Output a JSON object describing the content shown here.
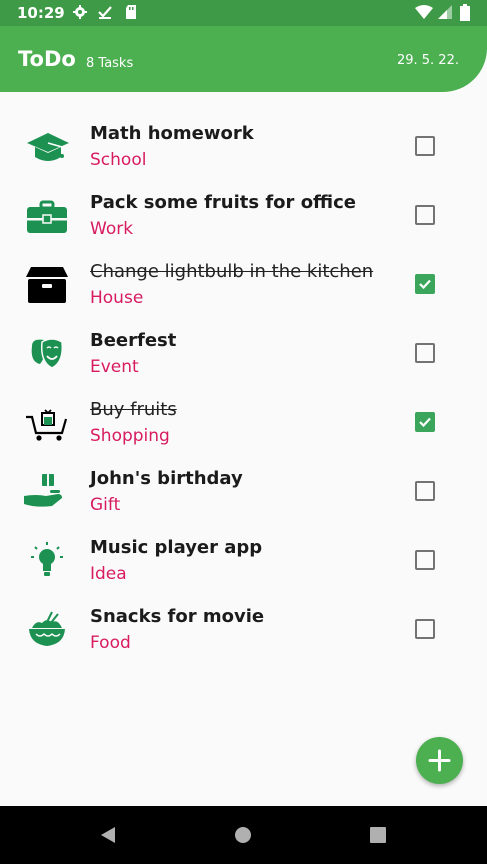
{
  "status_bar": {
    "time": "10:29"
  },
  "app_bar": {
    "title": "ToDo",
    "task_count": "8 Tasks",
    "date": "29. 5. 22."
  },
  "colors": {
    "primary": "#4caf50",
    "accent": "#d81b60",
    "icon": "#1d9152",
    "check": "#3aa55b"
  },
  "tasks": [
    {
      "title": "Math homework",
      "category": "School",
      "icon": "graduation-cap-icon",
      "done": false
    },
    {
      "title": "Pack some fruits for office",
      "category": "Work",
      "icon": "briefcase-icon",
      "done": false
    },
    {
      "title": "Change lightbulb in the kitchen",
      "category": "House",
      "icon": "box-icon",
      "done": true
    },
    {
      "title": "Beerfest",
      "category": "Event",
      "icon": "theater-masks-icon",
      "done": false
    },
    {
      "title": "Buy fruits",
      "category": "Shopping",
      "icon": "shopping-cart-icon",
      "done": true
    },
    {
      "title": "John's birthday",
      "category": "Gift",
      "icon": "gift-hand-icon",
      "done": false
    },
    {
      "title": "Music player app",
      "category": "Idea",
      "icon": "lightbulb-icon",
      "done": false
    },
    {
      "title": "Snacks for movie",
      "category": "Food",
      "icon": "food-bowl-icon",
      "done": false
    }
  ],
  "fab": {
    "icon": "plus-icon"
  },
  "nav": {
    "back_icon": "back-triangle-icon",
    "home_icon": "home-circle-icon",
    "recents_icon": "recents-square-icon"
  }
}
